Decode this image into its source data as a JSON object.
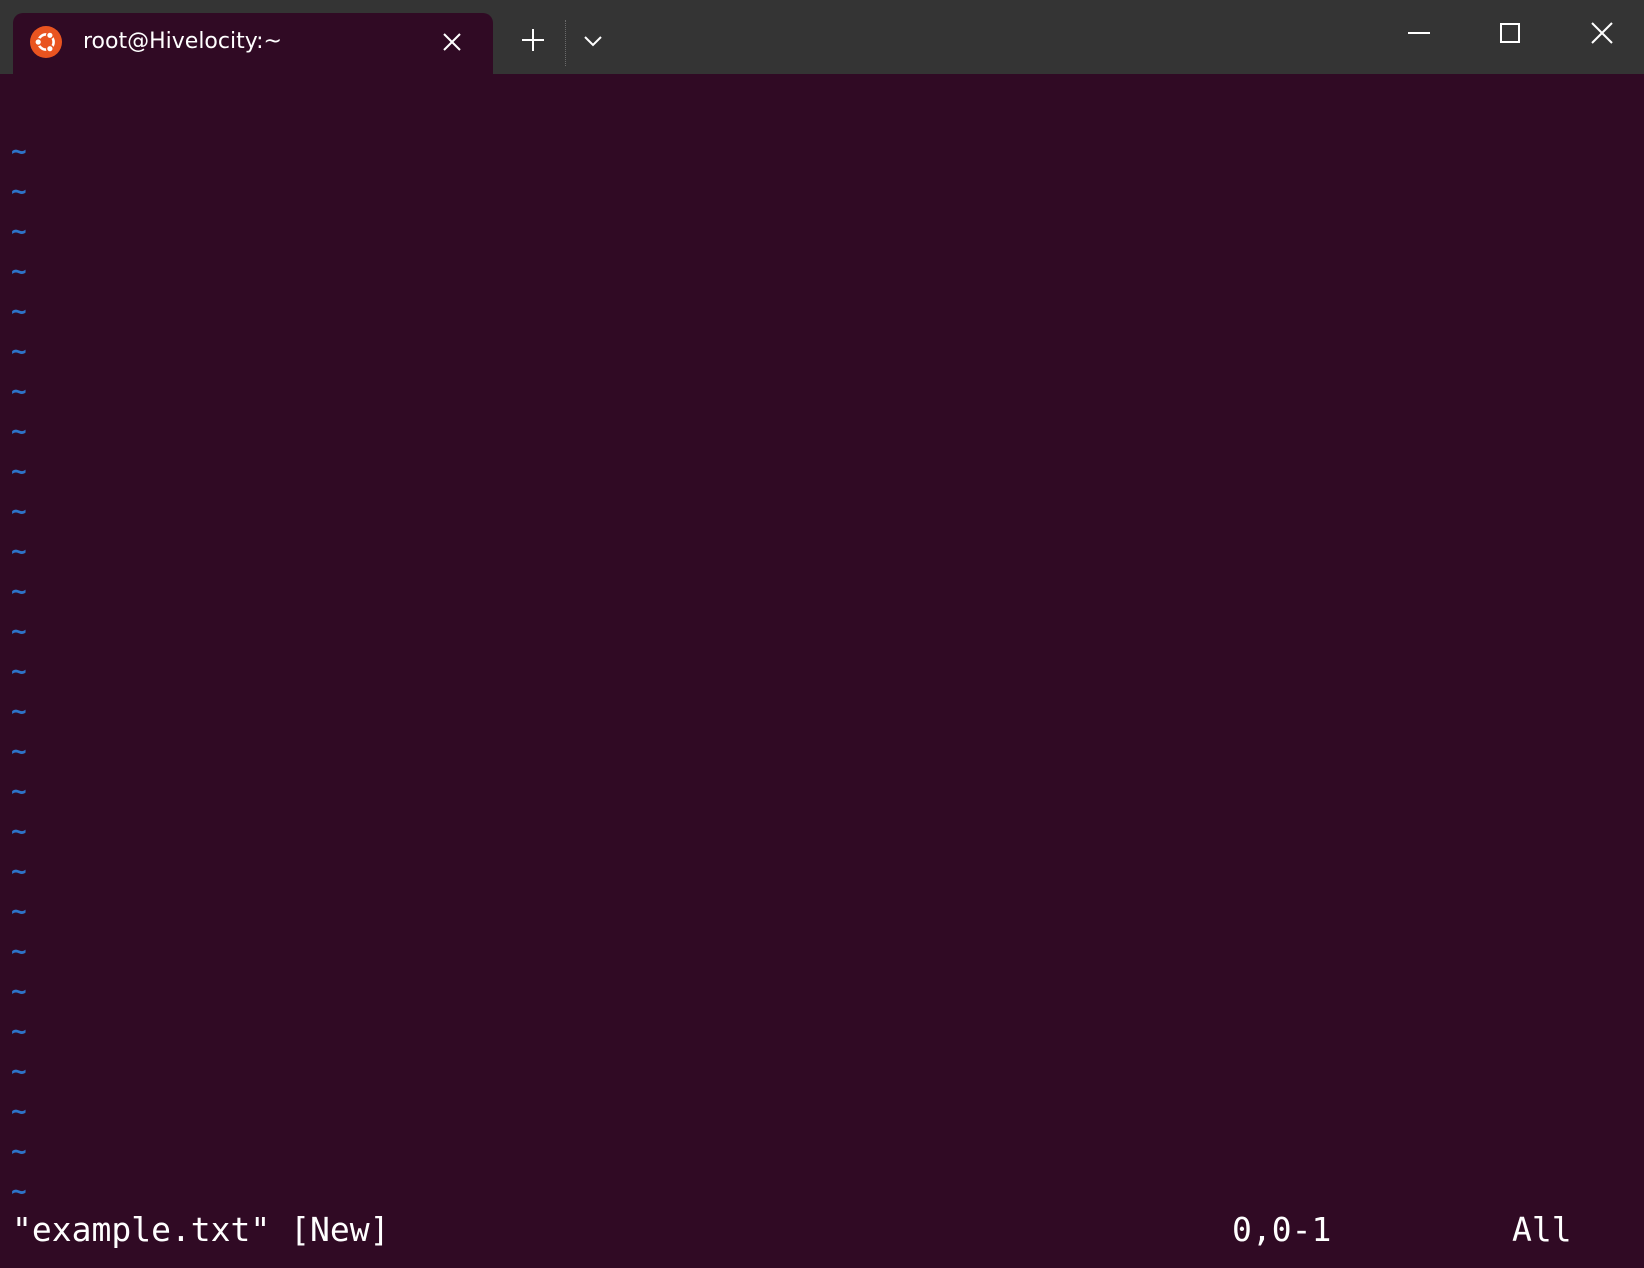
{
  "window": {
    "tab_title": "root@Hivelocity:~",
    "tab_icon": "ubuntu-logo-icon",
    "controls": [
      "minimize-icon",
      "maximize-icon",
      "close-icon"
    ],
    "accent_color": "#e95420",
    "titlebar_color": "#343434"
  },
  "terminal": {
    "background_color": "#300a24",
    "tilde_color": "#2d74c9",
    "empty_line_marker": "~",
    "empty_line_count": 27
  },
  "status_line": {
    "file": "\"example.txt\" [New]",
    "cursor_position": "0,0-1",
    "view": "All"
  }
}
